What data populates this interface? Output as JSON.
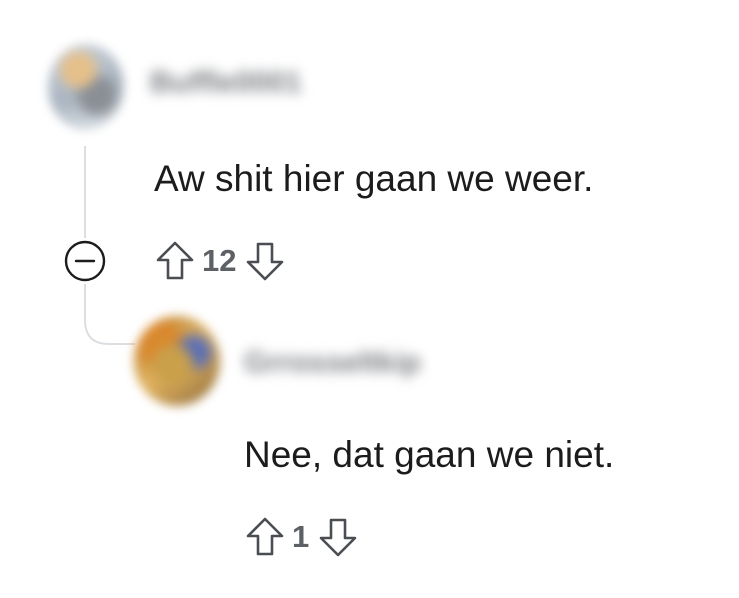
{
  "comments": [
    {
      "username": "Buffle0001",
      "body": "Aw shit hier gaan we weer.",
      "score": "12"
    },
    {
      "username": "Grrosseltkip",
      "body": "Nee, dat gaan we niet.",
      "score": "1"
    }
  ],
  "icons": {
    "upvote": "arrow-up-outline-icon",
    "downvote": "arrow-down-outline-icon",
    "collapse": "minus-circle-icon"
  },
  "colors": {
    "text": "#1c1c1c",
    "meta": "#5d6166",
    "thread_line": "#dcdfe2"
  }
}
